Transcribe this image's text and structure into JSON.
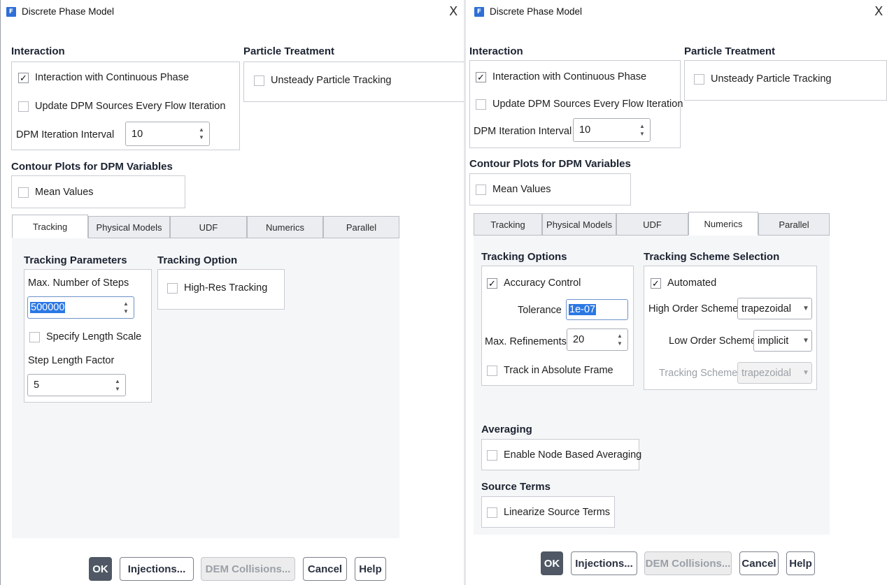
{
  "left": {
    "window_title": "Discrete Phase Model",
    "app_icon_letter": "F",
    "interaction": {
      "title": "Interaction",
      "continuous_phase": {
        "label": "Interaction with Continuous Phase",
        "checked": true
      },
      "update_dpm": {
        "label": "Update DPM Sources Every Flow Iteration",
        "checked": false
      },
      "interval_label": "DPM Iteration Interval",
      "interval_value": "10"
    },
    "particle_treatment": {
      "title": "Particle Treatment",
      "unsteady": {
        "label": "Unsteady Particle Tracking",
        "checked": false
      }
    },
    "contour": {
      "title": "Contour Plots for DPM Variables",
      "mean_values": {
        "label": "Mean Values",
        "checked": false
      }
    },
    "tabs": [
      "Tracking",
      "Physical Models",
      "UDF",
      "Numerics",
      "Parallel"
    ],
    "active_tab": "Tracking",
    "tracking_parameters": {
      "title": "Tracking Parameters",
      "max_steps_label": "Max. Number of Steps",
      "max_steps_value": "500000",
      "specify_length": {
        "label": "Specify Length Scale",
        "checked": false
      },
      "step_length_label": "Step Length Factor",
      "step_length_value": "5"
    },
    "tracking_option": {
      "title": "Tracking Option",
      "high_res": {
        "label": "High-Res Tracking",
        "checked": false
      }
    },
    "buttons": {
      "ok": "OK",
      "injections": "Injections...",
      "dem": "DEM Collisions...",
      "cancel": "Cancel",
      "help": "Help"
    }
  },
  "right": {
    "window_title": "Discrete Phase Model",
    "app_icon_letter": "F",
    "interaction": {
      "title": "Interaction",
      "continuous_phase": {
        "label": "Interaction with Continuous Phase",
        "checked": true
      },
      "update_dpm": {
        "label": "Update DPM Sources Every Flow Iteration",
        "checked": false
      },
      "interval_label": "DPM Iteration Interval",
      "interval_value": "10"
    },
    "particle_treatment": {
      "title": "Particle Treatment",
      "unsteady": {
        "label": "Unsteady Particle Tracking",
        "checked": false
      }
    },
    "contour": {
      "title": "Contour Plots for DPM Variables",
      "mean_values": {
        "label": "Mean Values",
        "checked": false
      }
    },
    "tabs": [
      "Tracking",
      "Physical Models",
      "UDF",
      "Numerics",
      "Parallel"
    ],
    "active_tab": "Numerics",
    "tracking_options": {
      "title": "Tracking Options",
      "accuracy": {
        "label": "Accuracy Control",
        "checked": true
      },
      "tolerance_label": "Tolerance",
      "tolerance_value": "1e-07",
      "max_ref_label": "Max. Refinements",
      "max_ref_value": "20",
      "absolute_frame": {
        "label": "Track in Absolute Frame",
        "checked": false
      }
    },
    "scheme_selection": {
      "title": "Tracking Scheme Selection",
      "automated": {
        "label": "Automated",
        "checked": true
      },
      "high_order_label": "High Order Scheme",
      "high_order_value": "trapezoidal",
      "low_order_label": "Low Order Scheme",
      "low_order_value": "implicit",
      "scheme_label": "Tracking Scheme",
      "scheme_value": "trapezoidal"
    },
    "averaging": {
      "title": "Averaging",
      "node_based": {
        "label": "Enable Node Based Averaging",
        "checked": false
      }
    },
    "source_terms": {
      "title": "Source Terms",
      "linearize": {
        "label": "Linearize Source Terms",
        "checked": false
      }
    },
    "buttons": {
      "ok": "OK",
      "injections": "Injections...",
      "dem": "DEM Collisions...",
      "cancel": "Cancel",
      "help": "Help"
    }
  },
  "glyphs": {
    "close": "X",
    "check": "✓",
    "spin_up": "▲",
    "spin_down": "▼",
    "dropdown": "▼"
  }
}
